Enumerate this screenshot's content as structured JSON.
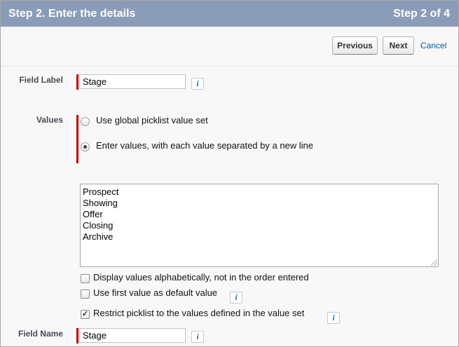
{
  "header": {
    "title": "Step 2. Enter the details",
    "step_indicator": "Step 2 of 4"
  },
  "toolbar": {
    "previous_label": "Previous",
    "next_label": "Next",
    "cancel_label": "Cancel"
  },
  "field_label": {
    "label": "Field Label",
    "value": "Stage"
  },
  "values": {
    "label": "Values",
    "options": [
      {
        "text": "Use global picklist value set",
        "selected": false
      },
      {
        "text": "Enter values, with each value separated by a new line",
        "selected": true
      }
    ],
    "entries": [
      "Prospect",
      "Showing",
      "Offer",
      "Closing",
      "Archive"
    ]
  },
  "checkboxes": [
    {
      "text": "Display values alphabetically, not in the order entered",
      "checked": false
    },
    {
      "text": "Use first value as default value",
      "checked": false
    },
    {
      "text": "Restrict picklist to the values defined in the value set",
      "checked": true
    }
  ],
  "field_name": {
    "label": "Field Name",
    "value": "Stage"
  },
  "info_glyph": "i",
  "checkmark_glyph": "✓"
}
